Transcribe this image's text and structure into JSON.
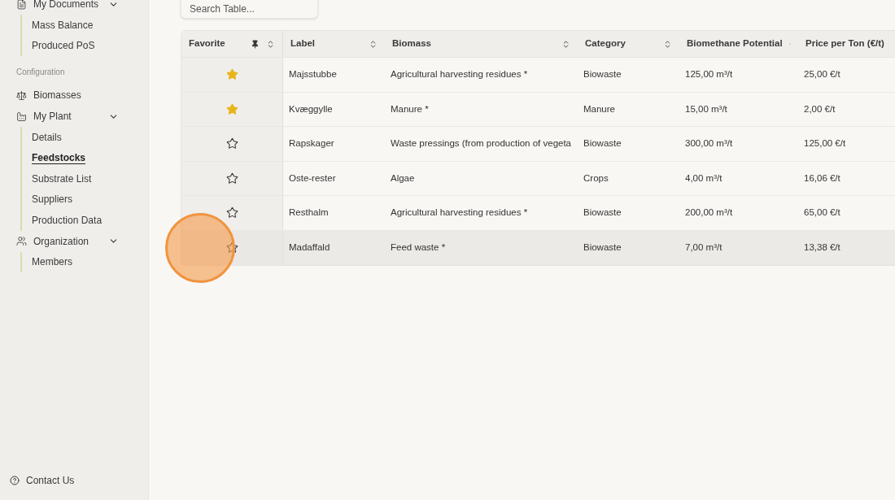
{
  "sidebar": {
    "sections": [
      {
        "kind": "group",
        "label": "My Documents",
        "expanded": true,
        "children": [
          {
            "label": "Mass Balance",
            "selected": false
          },
          {
            "label": "Produced PoS",
            "selected": false
          }
        ]
      },
      {
        "kind": "heading",
        "label": "Configuration"
      },
      {
        "kind": "link",
        "label": "Biomasses"
      },
      {
        "kind": "group",
        "label": "My Plant",
        "expanded": true,
        "children": [
          {
            "label": "Details",
            "selected": false
          },
          {
            "label": "Feedstocks",
            "selected": true
          },
          {
            "label": "Substrate List",
            "selected": false
          },
          {
            "label": "Suppliers",
            "selected": false
          },
          {
            "label": "Production Data",
            "selected": false
          }
        ]
      },
      {
        "kind": "group",
        "label": "Organization",
        "expanded": true,
        "children": [
          {
            "label": "Members",
            "selected": false
          }
        ]
      }
    ],
    "footer": {
      "label": "Contact Us"
    }
  },
  "search": {
    "placeholder": "Search Table..."
  },
  "table": {
    "favorite_column": {
      "label": "Favorite"
    },
    "columns": [
      "Label",
      "Biomass",
      "Category",
      "Biomethane Potential",
      "Price per Ton (€/t)"
    ],
    "rows": [
      {
        "favorite": true,
        "highlighted": false,
        "cells": [
          "Majsstubbe",
          "Agricultural harvesting residues *",
          "Biowaste",
          "125,00 m³/t",
          "25,00 €/t"
        ]
      },
      {
        "favorite": true,
        "highlighted": false,
        "cells": [
          "Kvæggylle",
          "Manure *",
          "Manure",
          "15,00 m³/t",
          "2,00 €/t"
        ]
      },
      {
        "favorite": false,
        "highlighted": false,
        "cells": [
          "Rapskager",
          "Waste pressings (from production of vegeta",
          "Biowaste",
          "300,00 m³/t",
          "125,00 €/t"
        ]
      },
      {
        "favorite": false,
        "highlighted": false,
        "cells": [
          "Oste-rester",
          "Algae",
          "Crops",
          "4,00 m³/t",
          "16,06 €/t"
        ]
      },
      {
        "favorite": false,
        "highlighted": false,
        "cells": [
          "Resthalm",
          "Agricultural harvesting residues *",
          "Biowaste",
          "200,00 m³/t",
          "65,00 €/t"
        ]
      },
      {
        "favorite": false,
        "highlighted": true,
        "cells": [
          "Madaffald",
          "Feed waste *",
          "Biowaste",
          "7,00 m³/t",
          "13,38 €/t"
        ]
      }
    ]
  }
}
